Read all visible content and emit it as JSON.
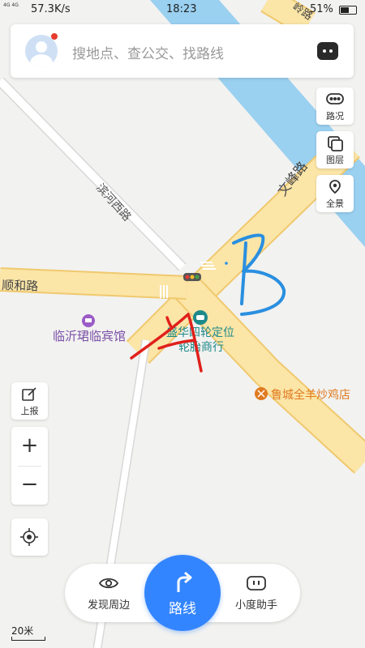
{
  "status_bar": {
    "network_type": "4G 4G",
    "speed": "57.3K/s",
    "time": "18:23",
    "battery": "51%"
  },
  "search": {
    "placeholder": "搜地点、查公交、找路线"
  },
  "tools": {
    "traffic": "路况",
    "layers": "图层",
    "panorama": "全景"
  },
  "left_tools": {
    "report": "上报",
    "zoom_in": "+",
    "zoom_out": "−"
  },
  "map": {
    "roads": {
      "wenfeng": "文峰路",
      "binhe_west": "滨河西路",
      "shunhe": "顺和路",
      "top_right": "岭路"
    },
    "pois": {
      "hotel": "临沂珺临宾馆",
      "tire_shop_line1": "盛华四轮定位",
      "tire_shop_line2": "轮胎商行",
      "restaurant": "鲁城全羊炒鸡店"
    },
    "annotations": {
      "a": "A",
      "b": "B"
    },
    "colors": {
      "road_major": "#fbe5a7",
      "road_edge": "#f0c96e",
      "river": "#9ad0f0",
      "hotel_icon": "#9b5cc7",
      "poi_text_purple": "#7a4fa8",
      "poi_text_teal": "#1d8a8a",
      "poi_text_orange": "#e07a1f",
      "annotation_red": "#e0201b",
      "annotation_blue": "#2a8fe0",
      "route_blue": "#3385ff"
    }
  },
  "bottom_bar": {
    "discover": "发现周边",
    "route": "路线",
    "assistant": "小度助手"
  },
  "scale": "20米"
}
